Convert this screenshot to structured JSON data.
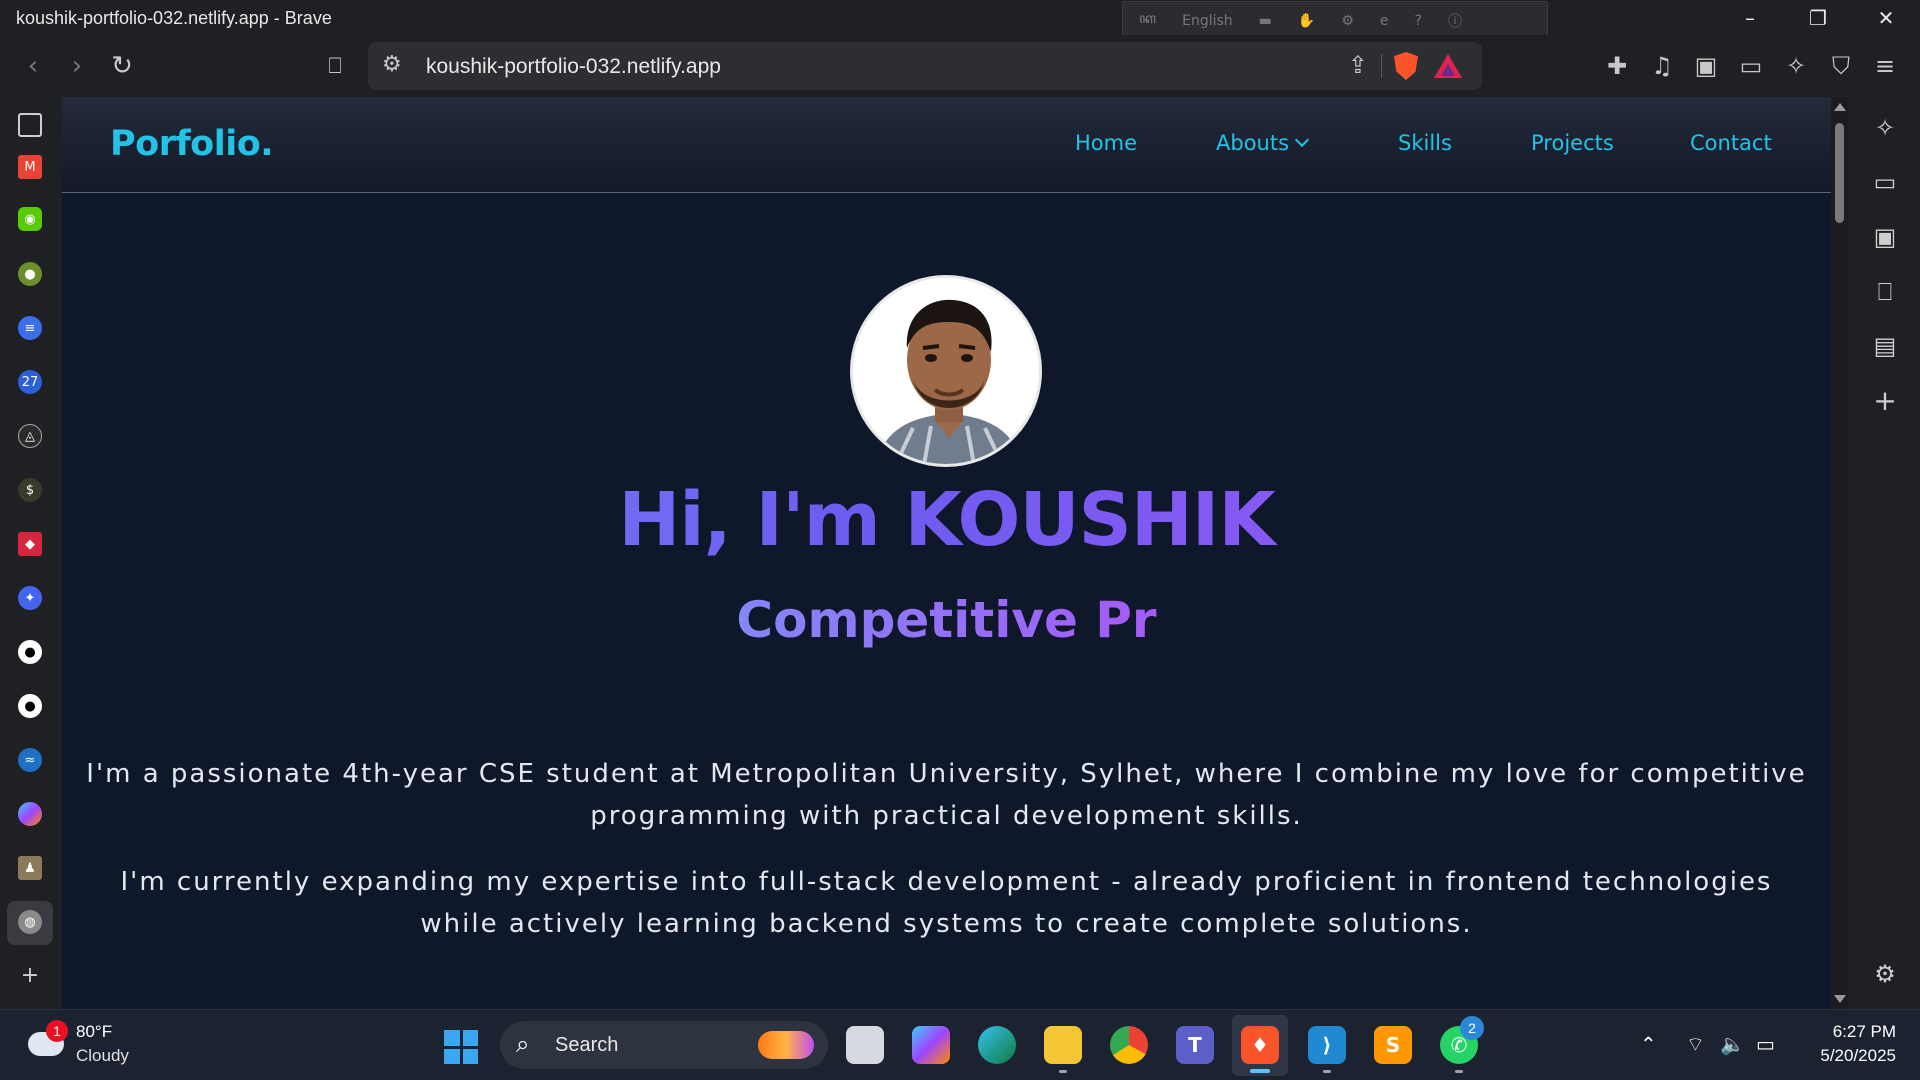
{
  "window": {
    "title": "koushik-portfolio-032.netlify.app - Brave",
    "ime_language": "English"
  },
  "toolbar": {
    "url": "koushik-portfolio-032.netlify.app"
  },
  "page": {
    "brand": "Porfolio.",
    "nav": {
      "home": "Home",
      "abouts": "Abouts",
      "skills": "Skills",
      "projects": "Projects",
      "contact": "Contact"
    },
    "hero_title": "Hi, I'm KOUSHIK",
    "hero_subtitle": "Competitive Pr",
    "paragraph_1": "I'm a passionate 4th-year CSE student at Metropolitan University, Sylhet, where I combine my love for competitive programming with practical development skills.",
    "paragraph_2": "I'm currently expanding my expertise into full-stack development - already proficient in frontend technologies while actively learning backend systems to create complete solutions."
  },
  "taskbar": {
    "weather_badge": "1",
    "temperature": "80°F",
    "condition": "Cloudy",
    "search_label": "Search",
    "whatsapp_badge": "2",
    "time": "6:27 PM",
    "date": "5/20/2025"
  },
  "colors": {
    "accent": "#22c3e6",
    "page_bg": "#0f172a",
    "hero_gradient_start": "#818cf8",
    "hero_gradient_end": "#a855f7"
  }
}
